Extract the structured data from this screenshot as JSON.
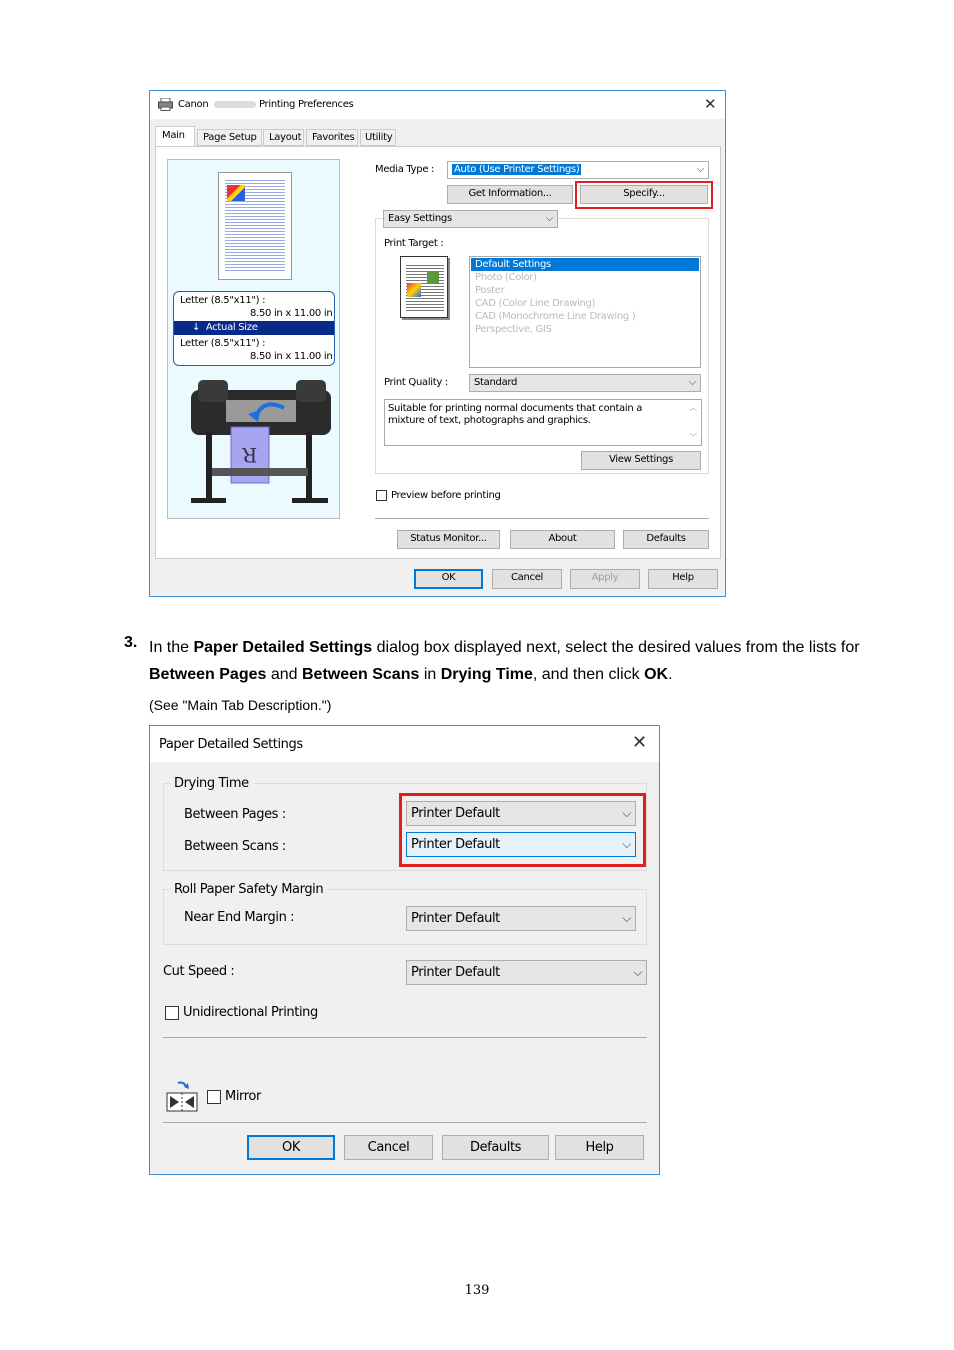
{
  "printing_prefs": {
    "title_parts": [
      "Canon",
      "Printing Preferences"
    ],
    "tabs": [
      "Main",
      "Page Setup",
      "Layout",
      "Favorites",
      "Utility"
    ],
    "preview_panel": {
      "paper_line1": "Letter (8.5\"x11\") :",
      "paper_size1": "8.50 in x 11.00 in",
      "actual_size": "Actual Size",
      "paper_line2": "Letter (8.5\"x11\") :",
      "paper_size2": "8.50 in x 11.00 in"
    },
    "media_type_label": "Media Type :",
    "media_type_value": "Auto (Use Printer Settings)",
    "get_information": "Get Information...",
    "specify": "Specify...",
    "easy_settings": "Easy Settings",
    "print_target_label": "Print Target :",
    "print_target_items": [
      "Default Settings",
      "Photo (Color)",
      "Poster",
      "CAD (Color Line Drawing)",
      "CAD (Monochrome Line Drawing )",
      "Perspective, GIS"
    ],
    "print_quality_label": "Print Quality :",
    "print_quality_value": "Standard",
    "description": "Suitable for printing normal documents that contain a mixture of text, photographs and graphics.",
    "view_settings": "View Settings",
    "preview_before_printing": "Preview before printing",
    "status_monitor": "Status Monitor...",
    "about": "About",
    "defaults": "Defaults",
    "ok": "OK",
    "cancel": "Cancel",
    "apply": "Apply",
    "help": "Help"
  },
  "step": {
    "number": "3.",
    "t1": "In the ",
    "b1": "Paper Detailed Settings",
    "t2": " dialog box displayed next, select the desired values from the lists for ",
    "b2": "Between Pages",
    "t3": " and ",
    "b3": "Between Scans",
    "t4": " in ",
    "b4": "Drying Time",
    "t5": ", and then click ",
    "b5": "OK",
    "t6": ".",
    "see": "(See \"Main Tab Description.\")"
  },
  "paper_detailed": {
    "title": "Paper Detailed Settings",
    "drying_time": "Drying Time",
    "between_pages_label": "Between Pages :",
    "between_pages_value": "Printer Default",
    "between_scans_label": "Between Scans :",
    "between_scans_value": "Printer Default",
    "roll_margin": "Roll Paper Safety Margin",
    "near_end_label": "Near End Margin :",
    "near_end_value": "Printer Default",
    "cut_speed_label": "Cut Speed :",
    "cut_speed_value": "Printer Default",
    "unidirectional": "Unidirectional Printing",
    "mirror": "Mirror",
    "ok": "OK",
    "cancel": "Cancel",
    "defaults": "Defaults",
    "help": "Help"
  },
  "page_number": "139",
  "colors": {
    "window_border": "#3c8fd8",
    "highlight": "#0078d7",
    "red_box": "#e02020"
  }
}
